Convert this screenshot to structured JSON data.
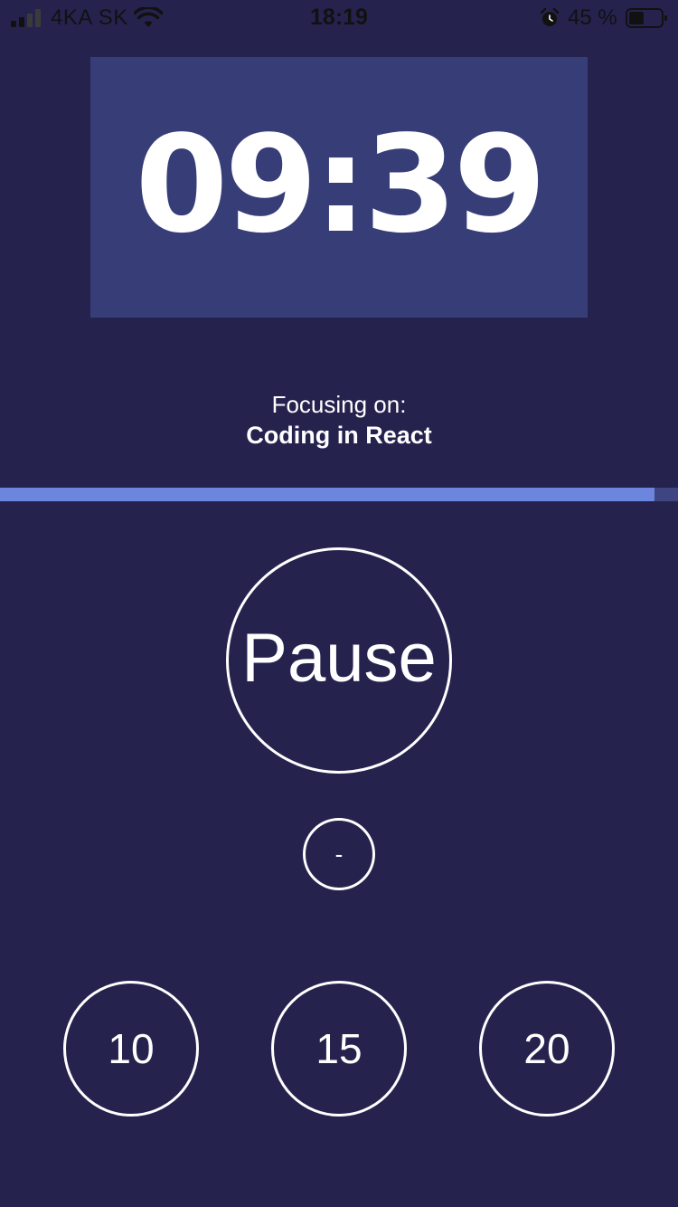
{
  "status_bar": {
    "carrier": "4KA SK",
    "time": "18:19",
    "battery_percent": "45 %",
    "icons": [
      "signal-icon",
      "wifi-icon",
      "alarm-icon",
      "battery-icon"
    ]
  },
  "timer": {
    "display": "09:39"
  },
  "focus": {
    "label": "Focusing on:",
    "subject": "Coding in React"
  },
  "progress": {
    "fraction": 0.965
  },
  "controls": {
    "pause_label": "Pause",
    "minus_label": "-",
    "presets": [
      "10",
      "15",
      "20"
    ]
  },
  "colors": {
    "background": "#25234e",
    "timer_box": "#373e77",
    "progress_fill": "#6b86dc",
    "progress_track": "#3e4580",
    "foreground": "#ffffff"
  }
}
